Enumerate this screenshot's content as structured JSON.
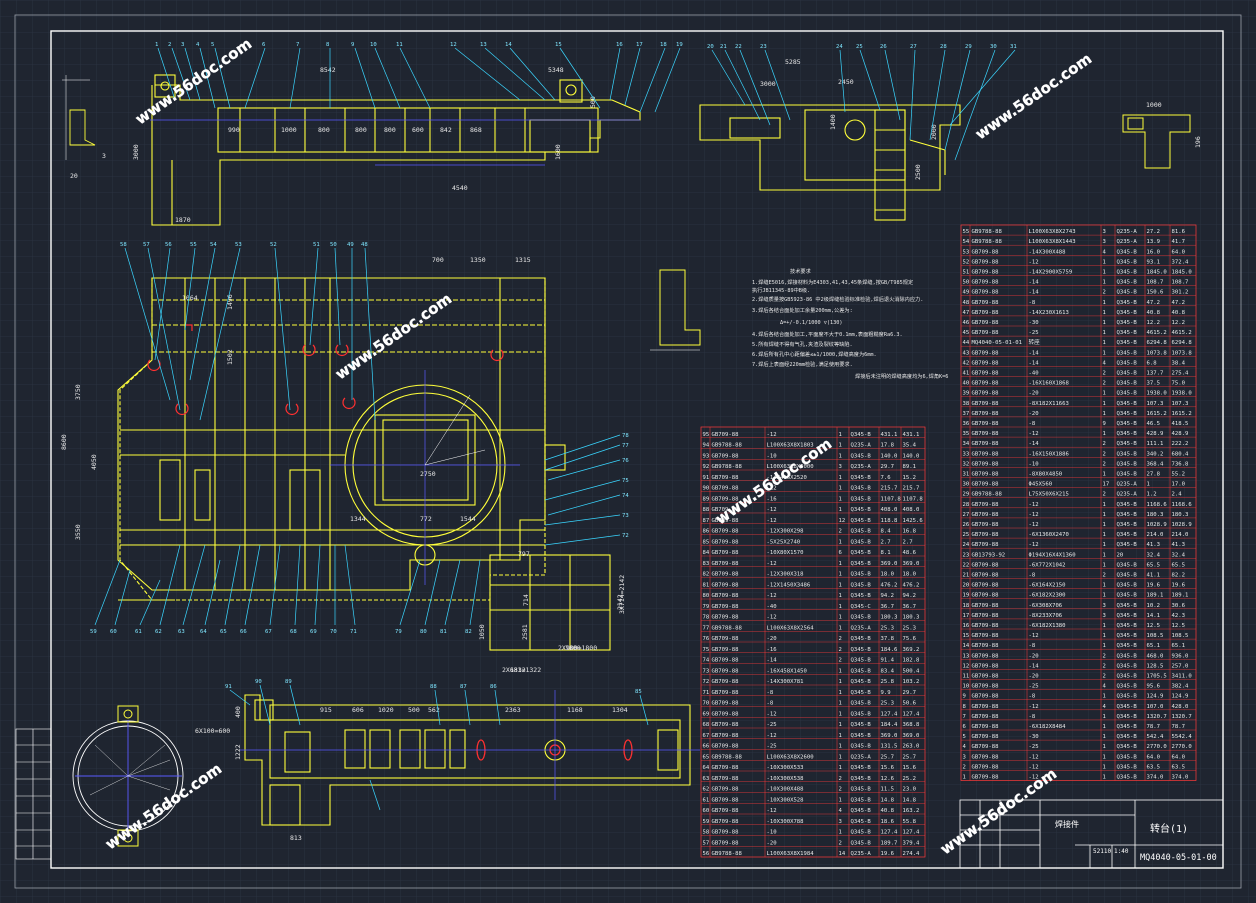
{
  "title_block": {
    "drawing_number": "MQ4040-05-01-00",
    "name": "转台(1)",
    "subtitle": "焊接件",
    "weight": "52110",
    "scale": "1:40"
  },
  "views": {
    "top_view_dims": [
      "8542",
      "5348",
      "4540",
      "1870",
      "3000",
      "3",
      "20"
    ],
    "top_view_inner": [
      "990",
      "1000",
      "800",
      "800",
      "800",
      "600",
      "842",
      "868",
      "1600",
      "500"
    ],
    "side_view_dims": [
      "5285",
      "2450",
      "3000",
      "2000",
      "2500",
      "1400"
    ],
    "plan_dims": [
      "700",
      "1350",
      "1315",
      "1064",
      "1496",
      "1502",
      "4050",
      "3750",
      "3550",
      "8600",
      "2750",
      "1344",
      "772",
      "1544",
      "797",
      "2142",
      "1332",
      "1800",
      "1050",
      "714",
      "2581"
    ],
    "bottom_dims": [
      "915",
      "606",
      "1020",
      "500",
      "562",
      "2363",
      "1168",
      "1304",
      "813",
      "1222",
      "400"
    ],
    "detail_dims": [
      "1000",
      "196",
      "6X100=600",
      "2X681=1322",
      "3X714=2142",
      "2X900=1800"
    ]
  },
  "tech_notes": {
    "heading": "技术要求",
    "lines": [
      "1.焊缝E5016,焊接材料为E4303,41,43,45条焊缝,按GB/T985规定",
      "  执行JB11345-89中B级.",
      "2.焊缝质量按GB5923-86 中2级焊缝检验标准检验,焊后退火消除内应力.",
      "3.焊后各结合面处加工余量200mm,公差为:",
      "  Δ=+/-0.1/1000    ▽(130)",
      "4.焊后各结合面处加工,平面度不大于0.1mm,表面粗糙度Ra6.3.",
      "5.所有焊缝不得有气孔,夹渣及裂纹等缺陷.",
      "6.焊后所有孔中心距偏差≤±1/1000,焊缝高度为6mm.",
      "7.焊后上表面经220mm检验,满足使用要求."
    ],
    "footer": "焊接后未注明的焊缝高度均为6,焊角K=6"
  },
  "parts_left": [
    [
      "95",
      "GB709-88",
      "-12",
      "1",
      "Q345-B",
      "431.1",
      "431.1"
    ],
    [
      "94",
      "GB9788-88",
      "L100X63X8X1803",
      "1",
      "Q235-A",
      "17.8",
      "35.4"
    ],
    [
      "93",
      "GB709-88",
      "-10",
      "1",
      "Q345-B",
      "140.0",
      "140.0"
    ],
    [
      "92",
      "GB9788-88",
      "L100X63X8X3000",
      "3",
      "Q235-A",
      "29.7",
      "89.1"
    ],
    [
      "91",
      "GB709-88",
      "-14X416X2520",
      "1",
      "Q345-B",
      "7.6",
      "15.2"
    ],
    [
      "90",
      "GB709-88",
      "-12",
      "1",
      "Q345-B",
      "215.7",
      "215.7"
    ],
    [
      "89",
      "GB709-88",
      "-16",
      "1",
      "Q345-B",
      "1107.8",
      "1107.8"
    ],
    [
      "88",
      "GB709-88",
      "-12",
      "1",
      "Q345-B",
      "408.0",
      "408.0"
    ],
    [
      "87",
      "GB709-88",
      "-12",
      "12",
      "Q345-B",
      "118.8",
      "1425.6"
    ],
    [
      "86",
      "GB709-88",
      "-12X300X298",
      "2",
      "Q345-B",
      "8.4",
      "16.8"
    ],
    [
      "85",
      "GB709-88",
      "-5X25X2740",
      "1",
      "Q345-B",
      "2.7",
      "2.7"
    ],
    [
      "84",
      "GB709-88",
      "-10X80X1570",
      "6",
      "Q345-B",
      "8.1",
      "48.6"
    ],
    [
      "83",
      "GB709-88",
      "-12",
      "1",
      "Q345-B",
      "369.0",
      "369.0"
    ],
    [
      "82",
      "GB709-88",
      "-12X300X318",
      "1",
      "Q345-B",
      "18.0",
      "18.0"
    ],
    [
      "81",
      "GB709-88",
      "-12X1450X3486",
      "1",
      "Q345-B",
      "476.2",
      "476.2"
    ],
    [
      "80",
      "GB709-88",
      "-12",
      "1",
      "Q345-B",
      "94.2",
      "94.2"
    ],
    [
      "79",
      "GB709-88",
      "-40",
      "1",
      "Q345-C",
      "36.7",
      "36.7"
    ],
    [
      "78",
      "GB709-88",
      "-12",
      "1",
      "Q345-B",
      "180.3",
      "180.3"
    ],
    [
      "77",
      "GB9788-88",
      "L100X63X8X2564",
      "1",
      "Q235-A",
      "25.3",
      "25.3"
    ],
    [
      "76",
      "GB709-88",
      "-20",
      "2",
      "Q345-B",
      "37.8",
      "75.6"
    ],
    [
      "75",
      "GB709-88",
      "-16",
      "2",
      "Q345-B",
      "184.6",
      "369.2"
    ],
    [
      "74",
      "GB709-88",
      "-14",
      "2",
      "Q345-B",
      "91.4",
      "182.8"
    ],
    [
      "73",
      "GB709-88",
      "-16X458X1450",
      "1",
      "Q345-B",
      "83.4",
      "500.4"
    ],
    [
      "72",
      "GB709-88",
      "-14X300X781",
      "1",
      "Q345-B",
      "25.8",
      "103.2"
    ],
    [
      "71",
      "GB709-88",
      "-8",
      "1",
      "Q345-B",
      "9.9",
      "29.7"
    ],
    [
      "70",
      "GB709-88",
      "-8",
      "1",
      "Q345-B",
      "25.3",
      "50.6"
    ],
    [
      "69",
      "GB709-88",
      "-12",
      "1",
      "Q345-B",
      "127.4",
      "127.4"
    ],
    [
      "68",
      "GB709-88",
      "-25",
      "1",
      "Q345-B",
      "184.4",
      "368.8"
    ],
    [
      "67",
      "GB709-88",
      "-12",
      "1",
      "Q345-B",
      "369.0",
      "369.0"
    ],
    [
      "66",
      "GB709-88",
      "-25",
      "1",
      "Q345-B",
      "131.5",
      "263.0"
    ],
    [
      "65",
      "GB9788-88",
      "L100X63X8X2600",
      "1",
      "Q235-A",
      "25.7",
      "25.7"
    ],
    [
      "64",
      "GB709-88",
      "-10X300X533",
      "1",
      "Q345-B",
      "15.6",
      "15.6"
    ],
    [
      "63",
      "GB709-88",
      "-10X300X538",
      "2",
      "Q345-B",
      "12.6",
      "25.2"
    ],
    [
      "62",
      "GB709-88",
      "-10X300X488",
      "2",
      "Q345-B",
      "11.5",
      "23.0"
    ],
    [
      "61",
      "GB709-88",
      "-10X300X528",
      "1",
      "Q345-B",
      "14.8",
      "14.8"
    ],
    [
      "60",
      "GB709-88",
      "-12",
      "4",
      "Q345-B",
      "40.8",
      "163.2"
    ],
    [
      "59",
      "GB709-88",
      "-10X300X788",
      "3",
      "Q345-B",
      "18.6",
      "55.8"
    ],
    [
      "58",
      "GB709-88",
      "-10",
      "1",
      "Q345-B",
      "127.4",
      "127.4"
    ],
    [
      "57",
      "GB709-88",
      "-20",
      "2",
      "Q345-B",
      "189.7",
      "379.4"
    ],
    [
      "56",
      "GB9788-88",
      "L100X63X8X1984",
      "14",
      "Q235-A",
      "19.6",
      "274.4"
    ]
  ],
  "parts_right": [
    [
      "55",
      "GB9788-88",
      "L100X63X8X2743",
      "3",
      "Q235-A",
      "27.2",
      "81.6"
    ],
    [
      "54",
      "GB9788-88",
      "L100X63X8X1443",
      "3",
      "Q235-A",
      "13.9",
      "41.7"
    ],
    [
      "53",
      "GB709-88",
      "-14X300X488",
      "4",
      "Q345-B",
      "16.0",
      "64.0"
    ],
    [
      "52",
      "GB709-88",
      "-12",
      "1",
      "Q345-B",
      "93.1",
      "372.4"
    ],
    [
      "51",
      "GB709-88",
      "-14X2900X5759",
      "1",
      "Q345-B",
      "1845.0",
      "1845.0"
    ],
    [
      "50",
      "GB709-88",
      "-14",
      "1",
      "Q345-B",
      "108.7",
      "108.7"
    ],
    [
      "49",
      "GB709-88",
      "-14",
      "2",
      "Q345-B",
      "150.6",
      "301.2"
    ],
    [
      "48",
      "GB709-88",
      "-8",
      "1",
      "Q345-B",
      "47.2",
      "47.2"
    ],
    [
      "47",
      "GB709-88",
      "-14X230X1613",
      "1",
      "Q345-B",
      "40.8",
      "40.8"
    ],
    [
      "46",
      "GB709-88",
      "-30",
      "1",
      "Q345-B",
      "12.2",
      "12.2"
    ],
    [
      "45",
      "GB709-88",
      "-25",
      "1",
      "Q345-B",
      "4615.2",
      "4615.2"
    ],
    [
      "44",
      "MQ4040-05-01-01",
      "转座",
      "1",
      "Q345-B",
      "6294.8",
      "6294.8"
    ],
    [
      "43",
      "GB709-88",
      "-14",
      "1",
      "Q345-B",
      "1073.8",
      "1073.8"
    ],
    [
      "42",
      "GB709-88",
      "-14",
      "4",
      "Q345-B",
      "6.8",
      "38.4"
    ],
    [
      "41",
      "GB709-88",
      "-40",
      "2",
      "Q345-B",
      "137.7",
      "275.4"
    ],
    [
      "40",
      "GB709-88",
      "-16X160X1868",
      "2",
      "Q345-B",
      "37.5",
      "75.0"
    ],
    [
      "39",
      "GB709-88",
      "-20",
      "1",
      "Q345-B",
      "1938.0",
      "1938.0"
    ],
    [
      "38",
      "GB709-88",
      "-8X182X11663",
      "1",
      "Q345-B",
      "107.3",
      "107.3"
    ],
    [
      "37",
      "GB709-88",
      "-20",
      "1",
      "Q345-B",
      "1615.2",
      "1615.2"
    ],
    [
      "36",
      "GB709-88",
      "-8",
      "9",
      "Q345-B",
      "46.5",
      "418.5"
    ],
    [
      "35",
      "GB709-88",
      "-12",
      "1",
      "Q345-B",
      "428.9",
      "428.9"
    ],
    [
      "34",
      "GB709-88",
      "-14",
      "2",
      "Q345-B",
      "111.1",
      "222.2"
    ],
    [
      "33",
      "GB709-88",
      "-16X150X1886",
      "2",
      "Q345-B",
      "340.2",
      "680.4"
    ],
    [
      "32",
      "GB709-88",
      "-10",
      "2",
      "Q345-B",
      "368.4",
      "736.8"
    ],
    [
      "31",
      "GB709-88",
      "-8X80X4850",
      "1",
      "Q345-B",
      "27.8",
      "55.2"
    ],
    [
      "30",
      "GB709-88",
      "Φ45X560",
      "17",
      "Q235-A",
      "1",
      "17.0"
    ],
    [
      "29",
      "GB9788-88",
      "L75X50X6X215",
      "2",
      "Q235-A",
      "1.2",
      "2.4"
    ],
    [
      "28",
      "GB709-88",
      "-12",
      "1",
      "Q345-B",
      "1168.6",
      "1168.6"
    ],
    [
      "27",
      "GB709-88",
      "-12",
      "1",
      "Q345-B",
      "180.3",
      "180.3"
    ],
    [
      "26",
      "GB709-88",
      "-12",
      "1",
      "Q345-B",
      "1028.9",
      "1028.9"
    ],
    [
      "25",
      "GB709-88",
      "-6X1360X2470",
      "1",
      "Q345-B",
      "214.0",
      "214.0"
    ],
    [
      "24",
      "GB709-88",
      "-12",
      "1",
      "Q345-B",
      "41.3",
      "41.3"
    ],
    [
      "23",
      "GB13793-92",
      "Φ194X16X4X1360",
      "1",
      "20",
      "32.4",
      "32.4"
    ],
    [
      "22",
      "GB709-88",
      "-6X772X1042",
      "1",
      "Q345-B",
      "65.5",
      "65.5"
    ],
    [
      "21",
      "GB709-88",
      "-8",
      "2",
      "Q345-B",
      "41.1",
      "82.2"
    ],
    [
      "20",
      "GB709-88",
      "-6X164X2150",
      "1",
      "Q345-B",
      "19.6",
      "19.6"
    ],
    [
      "19",
      "GB709-88",
      "-6X182X2300",
      "1",
      "Q345-B",
      "189.1",
      "189.1"
    ],
    [
      "18",
      "GB709-88",
      "-6X308X706",
      "3",
      "Q345-B",
      "10.2",
      "30.6"
    ],
    [
      "17",
      "GB709-88",
      "-8X233X706",
      "3",
      "Q345-B",
      "14.1",
      "42.3"
    ],
    [
      "16",
      "GB709-88",
      "-6X182X1380",
      "1",
      "Q345-B",
      "12.5",
      "12.5"
    ],
    [
      "15",
      "GB709-88",
      "-12",
      "1",
      "Q345-B",
      "108.5",
      "108.5"
    ],
    [
      "14",
      "GB709-88",
      "-8",
      "1",
      "Q345-B",
      "65.1",
      "65.1"
    ],
    [
      "13",
      "GB709-88",
      "-20",
      "2",
      "Q345-B",
      "468.0",
      "936.0"
    ],
    [
      "12",
      "GB709-88",
      "-14",
      "2",
      "Q345-B",
      "128.5",
      "257.0"
    ],
    [
      "11",
      "GB709-88",
      "-20",
      "2",
      "Q345-B",
      "1705.5",
      "3411.0"
    ],
    [
      "10",
      "GB709-88",
      "-25",
      "4",
      "Q345-B",
      "95.6",
      "382.4"
    ],
    [
      "9",
      "GB709-88",
      "-8",
      "1",
      "Q345-B",
      "124.9",
      "124.9"
    ],
    [
      "8",
      "GB709-88",
      "-12",
      "4",
      "Q345-B",
      "107.0",
      "428.0"
    ],
    [
      "7",
      "GB709-88",
      "-8",
      "1",
      "Q345-B",
      "1320.7",
      "1320.7"
    ],
    [
      "6",
      "GB709-88",
      "-6X182X8484",
      "1",
      "Q345-B",
      "78.7",
      "78.7"
    ],
    [
      "5",
      "GB709-88",
      "-30",
      "1",
      "Q345-B",
      "542.4",
      "5542.4"
    ],
    [
      "4",
      "GB709-88",
      "-25",
      "1",
      "Q345-B",
      "2770.0",
      "2770.0"
    ],
    [
      "3",
      "GB709-88",
      "-12",
      "1",
      "Q345-B",
      "64.0",
      "64.0"
    ],
    [
      "2",
      "GB709-88",
      "-12",
      "1",
      "Q345-B",
      "63.5",
      "63.5"
    ],
    [
      "1",
      "GB709-88",
      "-12",
      "1",
      "Q345-B",
      "374.0",
      "374.0"
    ]
  ],
  "watermark": "www.56doc.com",
  "colors": {
    "background": "#1f2530",
    "grid": "#2d3543",
    "frame": "#ffffff",
    "outline": "#ffff3a",
    "callout": "#3ad6ff",
    "table_line": "#ff3a3a",
    "center_line": "#5a5aff",
    "hidden": "#ff3030"
  }
}
